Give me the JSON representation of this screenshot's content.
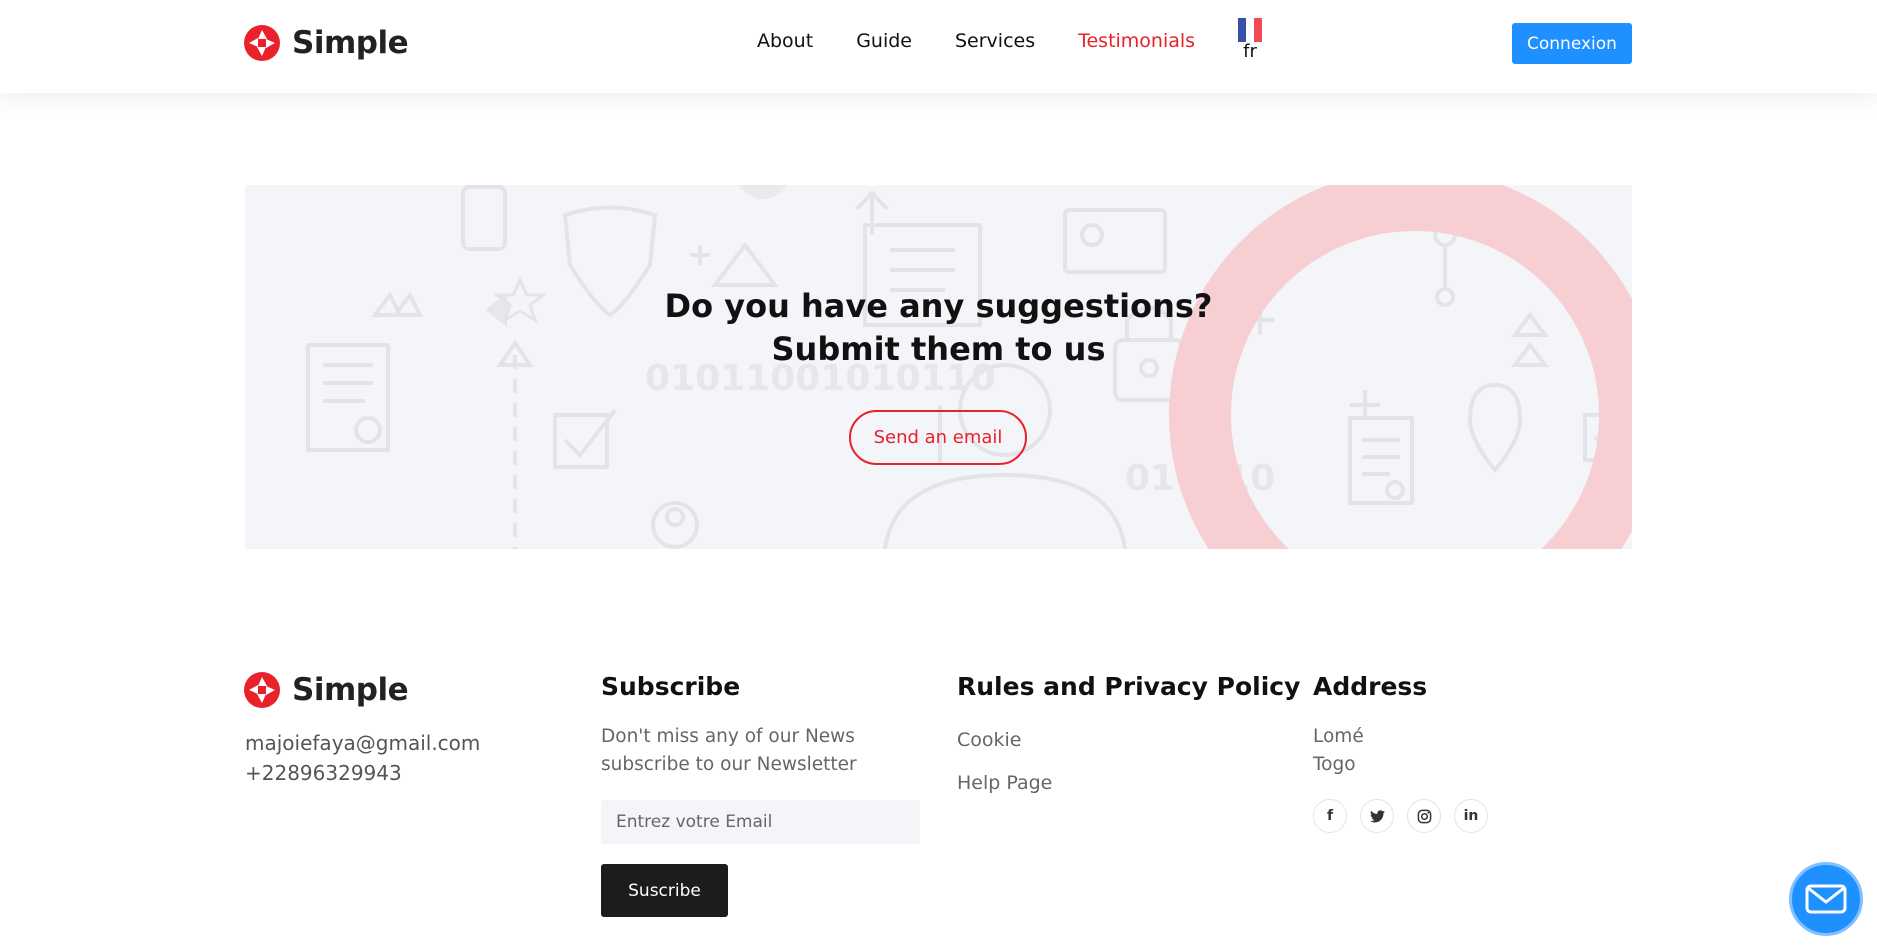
{
  "header": {
    "brand": "Simple",
    "nav": [
      {
        "label": "About",
        "active": false
      },
      {
        "label": "Guide",
        "active": false
      },
      {
        "label": "Services",
        "active": false
      },
      {
        "label": "Testimonials",
        "active": true
      }
    ],
    "language": {
      "code": "fr",
      "flag_colors": [
        "#3b50a8",
        "#ffffff",
        "#ef4b54"
      ]
    },
    "login_label": "Connexion"
  },
  "banner": {
    "title_line1": "Do you have any suggestions?",
    "title_line2": "Submit them to us",
    "button_label": "Send an email",
    "decor_text": [
      "01011001010110",
      "010110"
    ]
  },
  "footer": {
    "brand": "Simple",
    "email": "majoiefaya@gmail.com",
    "phone": "+22896329943",
    "subscribe": {
      "title": "Subscribe",
      "text_line1": "Don't miss any of our News",
      "text_line2": "subscribe to our Newsletter",
      "placeholder": "Entrez votre Email",
      "button_label": "Suscribe"
    },
    "policy": {
      "title": "Rules and Privacy Policy",
      "links": [
        "Cookie",
        "Help Page"
      ]
    },
    "address": {
      "title": "Address",
      "line1": "Lomé",
      "line2": "Togo"
    },
    "socials": [
      {
        "icon": "facebook-icon",
        "glyph": "f"
      },
      {
        "icon": "twitter-icon",
        "glyph": "t"
      },
      {
        "icon": "instagram-icon",
        "glyph": "◎"
      },
      {
        "icon": "linkedin-icon",
        "glyph": "in"
      }
    ]
  },
  "colors": {
    "accent_red": "#e8212a",
    "primary_blue": "#1e90ff",
    "dark": "#1d1c1c"
  },
  "chat_widget": {
    "icon": "mail-icon"
  }
}
